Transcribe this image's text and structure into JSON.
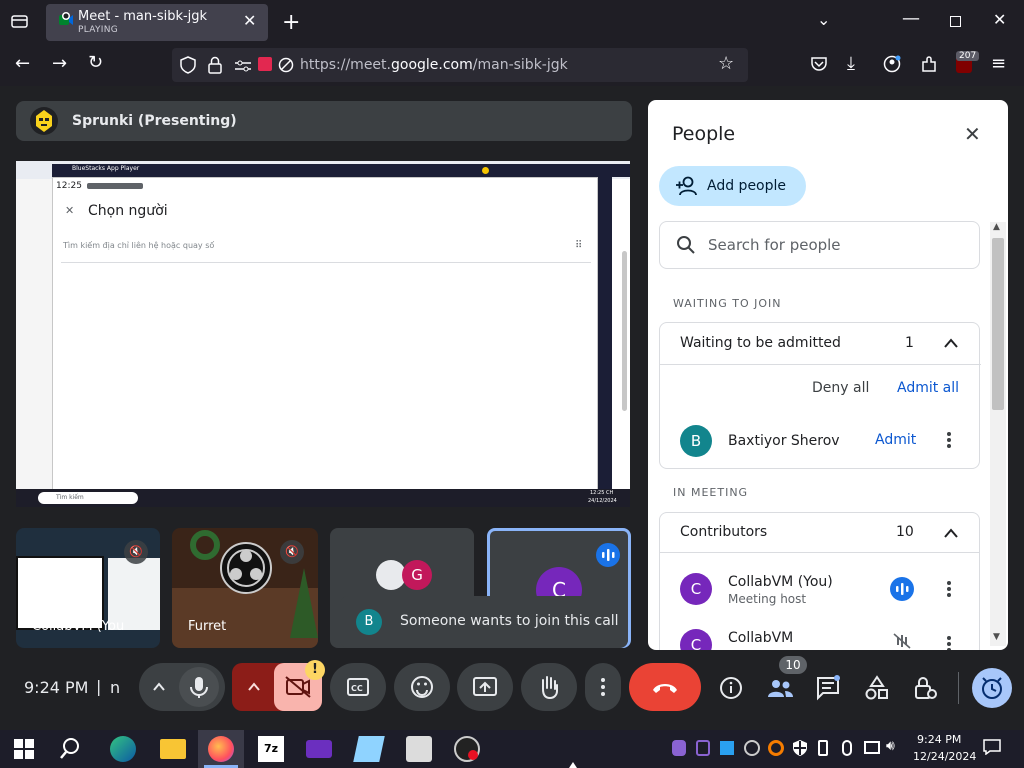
{
  "browser": {
    "tab_title": "Meet - man-sibk-jgk",
    "tab_status": "PLAYING",
    "url_prefix": "https://meet.",
    "url_domain": "google.com",
    "url_path": "/man-sibk-jgk",
    "extension_badge": "207"
  },
  "meet": {
    "presenter_label": "Sprunki (Presenting)",
    "shared_screen": {
      "app_title": "BlueStacks App Player",
      "time": "12:25",
      "dialog_title": "Chọn người",
      "search_placeholder": "Tìm kiếm địa chỉ liên hệ hoặc quay số",
      "taskbar_search": "Tìm kiếm",
      "taskbar_clock_time": "12:25 CH",
      "taskbar_clock_date": "24/12/2024"
    },
    "tiles": [
      {
        "name": "CollabVM (You"
      },
      {
        "name": "Furret"
      },
      {
        "name": "",
        "avatar_letter": "G"
      },
      {
        "name": "",
        "avatar_letter": "C"
      }
    ],
    "toast": {
      "avatar": "B",
      "text": "Someone wants to join this call"
    },
    "people_panel": {
      "title": "People",
      "add_people": "Add people",
      "search_placeholder": "Search for people",
      "waiting_section": "WAITING TO JOIN",
      "waiting_group": "Waiting to be admitted",
      "waiting_count": "1",
      "deny_all": "Deny all",
      "admit_all": "Admit all",
      "waiting_person": {
        "avatar": "B",
        "name": "Baxtiyor Sherov",
        "action": "Admit"
      },
      "meeting_section": "IN MEETING",
      "contributors_label": "Contributors",
      "contributors_count": "10",
      "members": [
        {
          "avatar": "C",
          "name": "CollabVM (You)",
          "role": "Meeting host"
        },
        {
          "avatar": "C",
          "name": "CollabVM",
          "role": ""
        }
      ]
    },
    "controls": {
      "time": "9:24 PM",
      "separator": "|",
      "meeting_code": "n",
      "participants_badge": "10",
      "camera_warning": "!"
    }
  },
  "taskbar": {
    "time": "9:24 PM",
    "date": "12/24/2024",
    "pinned": [
      "start",
      "search",
      "edge",
      "file-explorer",
      "firefox",
      "7zip",
      "app-purple",
      "app-notepad",
      "app-hardware",
      "app-obs"
    ]
  },
  "colors": {
    "accent": "#1a73e8",
    "end_call": "#ea4335",
    "camera_off": "#8c1d18",
    "panel_bg": "#ffffff",
    "meet_bg": "#202124"
  }
}
